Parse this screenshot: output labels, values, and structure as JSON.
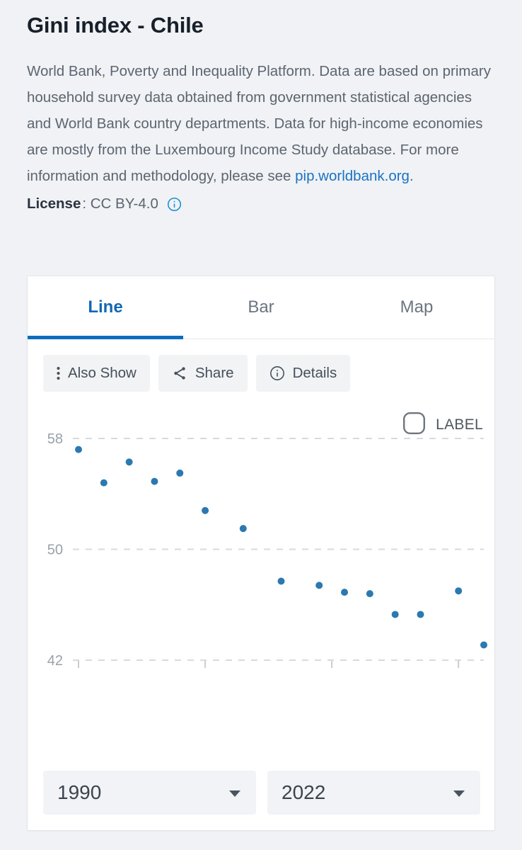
{
  "header": {
    "title": "Gini index - Chile",
    "description_before_link": "World Bank, Poverty and Inequality Platform. Data are based on primary household survey data obtained from government statistical agencies and World Bank country departments. Data for high-income economies are mostly from the Luxembourg Income Study database. For more information and methodology, please see ",
    "description_link": "pip.worldbank.org",
    "description_after_link": ".",
    "license_label": "License",
    "license_value": ": CC BY-4.0",
    "info_icon": "info-circle-icon"
  },
  "tabs": [
    {
      "label": "Line",
      "active": true
    },
    {
      "label": "Bar",
      "active": false
    },
    {
      "label": "Map",
      "active": false
    }
  ],
  "toolbar": [
    {
      "label": "Also Show",
      "icon": "vertical-dots-icon"
    },
    {
      "label": "Share",
      "icon": "share-icon"
    },
    {
      "label": "Details",
      "icon": "info-circle-icon"
    }
  ],
  "legend": {
    "swatch_icon": "rounded-square-outline-icon",
    "label": "LABEL"
  },
  "year_range": {
    "start": "1990",
    "end": "2022",
    "caret_icon": "chevron-down-icon"
  },
  "colors": {
    "accent": "#0d6ebd",
    "tab_active": "#1268b3",
    "point": "#2b79b0",
    "gridline": "#d8dadd",
    "axis_text": "#9aa1a9",
    "page_bg": "#f0f2f5",
    "card_bg": "#ffffff",
    "button_bg": "#f1f3f5",
    "link": "#1a73c4"
  },
  "chart_data": {
    "type": "scatter",
    "title": "Gini index - Chile",
    "xlabel": "",
    "ylabel": "",
    "ylim": [
      42,
      58
    ],
    "yticks": [
      "58",
      "50",
      "42"
    ],
    "ytick_values": [
      58,
      50,
      42
    ],
    "xlim": [
      1990,
      2022
    ],
    "xticks": [
      1990,
      2000,
      2010,
      2020
    ],
    "grid": true,
    "legend_position": "top-right",
    "series": [
      {
        "name": "LABEL",
        "color": "#2b79b0",
        "x": [
          1990,
          1992,
          1994,
          1996,
          1998,
          2000,
          2003,
          2006,
          2009,
          2011,
          2013,
          2015,
          2017,
          2020,
          2022
        ],
        "values": [
          57.2,
          54.8,
          56.3,
          54.9,
          55.5,
          52.8,
          51.5,
          47.7,
          47.4,
          46.9,
          46.8,
          45.3,
          45.3,
          47.0,
          43.1
        ]
      }
    ]
  }
}
